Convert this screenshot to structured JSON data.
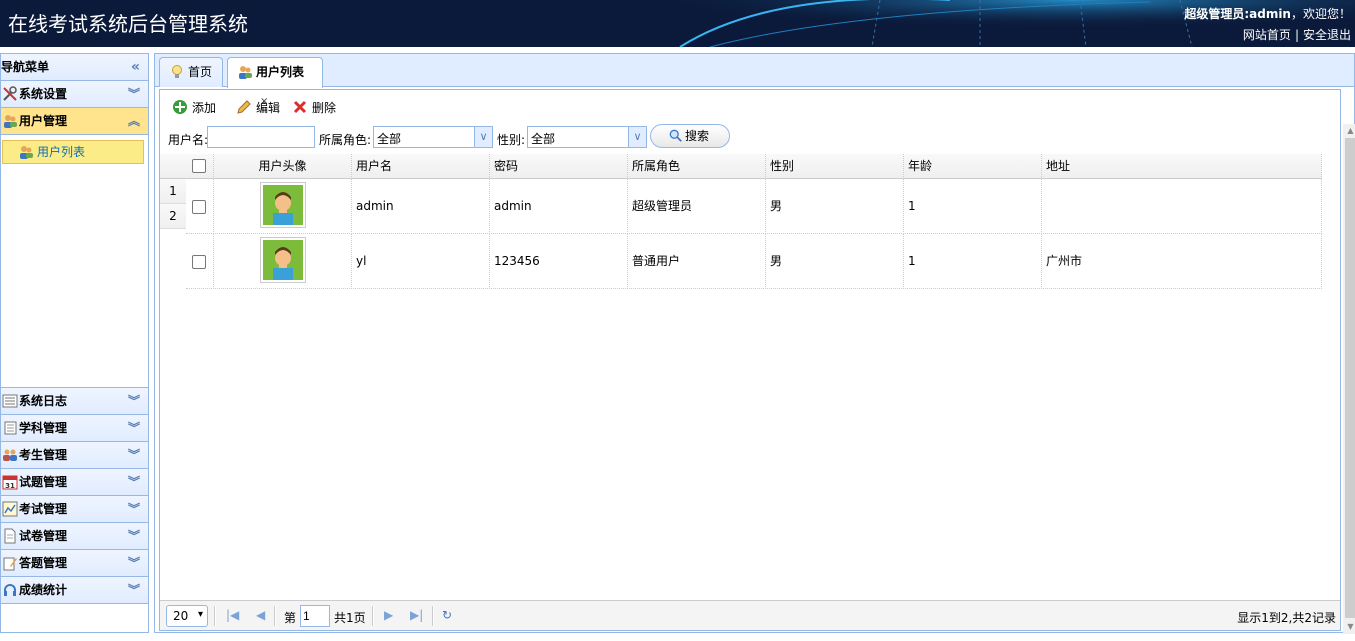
{
  "header": {
    "title": "在线考试系统后台管理系统",
    "welcome_role": "超级管理员:admin",
    "welcome_text": "，欢迎您！",
    "link_home": "网站首页",
    "link_sep": "|",
    "link_logout": "安全退出"
  },
  "sidebar": {
    "title": "导航菜单",
    "collapse_glyph": "«",
    "menus": [
      {
        "label": "系统设置",
        "icon": "tools-icon",
        "expanded": false
      },
      {
        "label": "用户管理",
        "icon": "users-icon",
        "expanded": true
      },
      {
        "label": "系统日志",
        "icon": "log-icon",
        "expanded": false
      },
      {
        "label": "学科管理",
        "icon": "list-icon",
        "expanded": false
      },
      {
        "label": "考生管理",
        "icon": "group-icon",
        "expanded": false
      },
      {
        "label": "试题管理",
        "icon": "calendar-icon",
        "expanded": false
      },
      {
        "label": "考试管理",
        "icon": "chart-icon",
        "expanded": false
      },
      {
        "label": "试卷管理",
        "icon": "document-icon",
        "expanded": false
      },
      {
        "label": "答题管理",
        "icon": "pen-icon",
        "expanded": false
      },
      {
        "label": "成绩统计",
        "icon": "headset-icon",
        "expanded": false
      }
    ],
    "submenu_item": "用户列表"
  },
  "tabs": [
    {
      "label": "首页",
      "icon": "bulb-icon",
      "closable": false,
      "active": false
    },
    {
      "label": "用户列表",
      "icon": "users-icon",
      "closable": true,
      "active": true,
      "close_glyph": "×"
    }
  ],
  "toolbar": {
    "add_label": "添加",
    "edit_label": "编辑",
    "delete_label": "删除"
  },
  "search": {
    "username_label": "用户名:",
    "username_value": "",
    "role_label": "所属角色:",
    "role_value": "全部",
    "gender_label": "性别:",
    "gender_value": "全部",
    "search_button": "搜索"
  },
  "grid": {
    "columns": [
      "用户头像",
      "用户名",
      "密码",
      "所属角色",
      "性别",
      "年龄",
      "地址"
    ],
    "row_numbers": [
      "1",
      "2"
    ],
    "rows": [
      {
        "username": "admin",
        "password": "admin",
        "role": "超级管理员",
        "gender": "男",
        "age": "1",
        "address": ""
      },
      {
        "username": "yl",
        "password": "123456",
        "role": "普通用户",
        "gender": "男",
        "age": "1",
        "address": "广州市"
      }
    ]
  },
  "pager": {
    "page_size": "20",
    "page_prefix": "第",
    "page_value": "1",
    "page_suffix": "共1页",
    "info": "显示1到2,共2记录"
  },
  "colors": {
    "header_bg": "#0b1a3a",
    "border": "#95b8e7",
    "panel_bg": "#e0ecff",
    "active_menu": "#ffe48d"
  }
}
